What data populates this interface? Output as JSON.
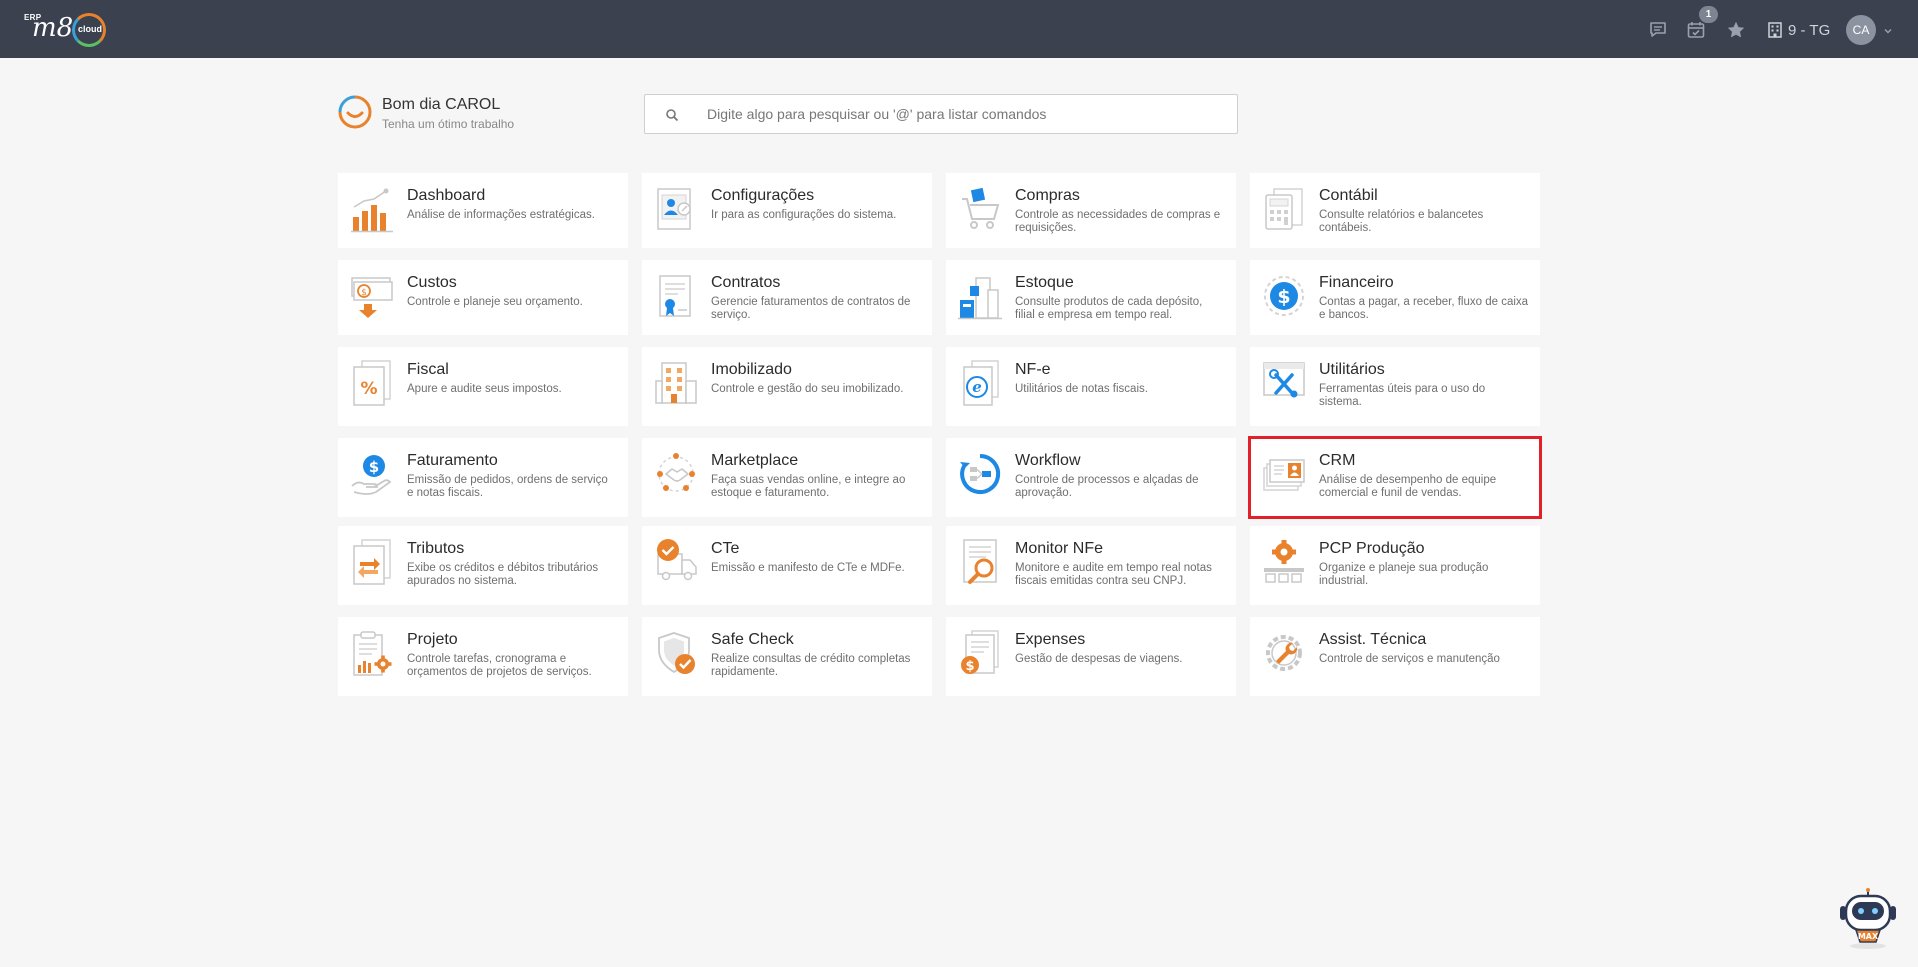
{
  "topbar": {
    "logo": {
      "erp": "ERP",
      "m8": "m8",
      "cloud": "cloud"
    },
    "notification_count": "1",
    "company": "9 - TG",
    "avatar_initials": "CA",
    "icons": [
      "chat-icon",
      "calendar-check-icon",
      "star-icon",
      "building-icon",
      "chevron-down-icon"
    ]
  },
  "greeting": {
    "title": "Bom dia CAROL",
    "subtitle": "Tenha um ótimo trabalho"
  },
  "search": {
    "placeholder": "Digite algo para pesquisar ou '@' para listar comandos",
    "value": ""
  },
  "modules": [
    {
      "title": "Dashboard",
      "desc": "Análise de informações estratégicas.",
      "icon": "bar-chart-icon"
    },
    {
      "title": "Configurações",
      "desc": "Ir para as configurações do sistema.",
      "icon": "user-settings-icon"
    },
    {
      "title": "Compras",
      "desc": "Controle as necessidades de compras e requisições.",
      "icon": "shopping-cart-icon"
    },
    {
      "title": "Contábil",
      "desc": "Consulte relatórios e balancetes contábeis.",
      "icon": "calculator-icon"
    },
    {
      "title": "Custos",
      "desc": "Controle e planeje seu orçamento.",
      "icon": "money-down-icon"
    },
    {
      "title": "Contratos",
      "desc": "Gerencie faturamentos de contratos de serviço.",
      "icon": "contract-icon"
    },
    {
      "title": "Estoque",
      "desc": "Consulte produtos de cada depósito, filial e empresa em tempo real.",
      "icon": "warehouse-icon"
    },
    {
      "title": "Financeiro",
      "desc": "Contas a pagar, a receber, fluxo de caixa e bancos.",
      "icon": "dollar-coin-icon"
    },
    {
      "title": "Fiscal",
      "desc": "Apure e audite seus impostos.",
      "icon": "percent-document-icon"
    },
    {
      "title": "Imobilizado",
      "desc": "Controle e gestão do seu imobilizado.",
      "icon": "building-assets-icon"
    },
    {
      "title": "NF-e",
      "desc": "Utilitários de notas fiscais.",
      "icon": "e-document-icon"
    },
    {
      "title": "Utilitários",
      "desc": "Ferramentas úteis para o uso do sistema.",
      "icon": "tools-icon"
    },
    {
      "title": "Faturamento",
      "desc": "Emissão de pedidos, ordens de serviço e notas fiscais.",
      "icon": "hand-dollar-icon"
    },
    {
      "title": "Marketplace",
      "desc": "Faça suas vendas online, e integre ao estoque e faturamento.",
      "icon": "handshake-network-icon"
    },
    {
      "title": "Workflow",
      "desc": "Controle de processos e alçadas de aprovação.",
      "icon": "workflow-icon"
    },
    {
      "title": "CRM",
      "desc": "Análise de desempenho de equipe comercial e funil de vendas.",
      "icon": "crm-card-icon"
    },
    {
      "title": "Tributos",
      "desc": "Exibe os créditos e débitos tributários apurados no sistema.",
      "icon": "exchange-document-icon"
    },
    {
      "title": "CTe",
      "desc": "Emissão e manifesto de CTe e MDFe.",
      "icon": "truck-check-icon"
    },
    {
      "title": "Monitor NFe",
      "desc": "Monitore e audite em tempo real notas fiscais emitidas contra seu CNPJ.",
      "icon": "magnifier-document-icon"
    },
    {
      "title": "PCP Produção",
      "desc": "Organize e planeje sua produção industrial.",
      "icon": "gear-production-icon"
    },
    {
      "title": "Projeto",
      "desc": "Controle tarefas, cronograma e orçamentos de projetos de serviços.",
      "icon": "clipboard-gear-icon"
    },
    {
      "title": "Safe Check",
      "desc": "Realize consultas de crédito completas rapidamente.",
      "icon": "shield-check-icon"
    },
    {
      "title": "Expenses",
      "desc": "Gestão de despesas de viagens.",
      "icon": "expenses-icon"
    },
    {
      "title": "Assist. Técnica",
      "desc": "Controle de serviços e manutenção",
      "icon": "gear-wrench-icon"
    }
  ],
  "selected_module": "CRM",
  "assistant": {
    "label": "MAX"
  },
  "colors": {
    "topbar": "#3b414f",
    "accent_orange": "#e9822c",
    "accent_blue": "#1e88e5",
    "selection": "#e1202a"
  }
}
